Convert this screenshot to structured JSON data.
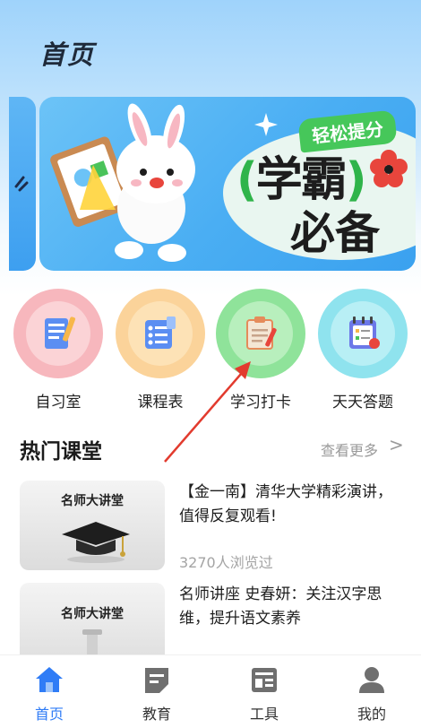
{
  "header": {
    "title": "首页"
  },
  "banner": {
    "tag": "轻松提分",
    "headline_bracket_left": "(",
    "headline_line1": "学霸",
    "headline_bracket_right": ")",
    "headline_line2": "必备",
    "accent_color": "#46c75a"
  },
  "shortcuts": [
    {
      "label": "自习室",
      "icon": "study-room-icon",
      "ring": "#f7b7bd",
      "inner": "#fbd3d6"
    },
    {
      "label": "课程表",
      "icon": "schedule-icon",
      "ring": "#fbd39a",
      "inner": "#fde2b6"
    },
    {
      "label": "学习打卡",
      "icon": "check-in-icon",
      "ring": "#8fe39a",
      "inner": "#b8efbd"
    },
    {
      "label": "天天答题",
      "icon": "daily-quiz-icon",
      "ring": "#8fe3ee",
      "inner": "#b8eff5"
    }
  ],
  "hot_courses": {
    "title": "热门课堂",
    "more_label": "查看更多",
    "more_chevron": ">",
    "items": [
      {
        "thumb_title": "名师大讲堂",
        "title": "【金一南】清华大学精彩演讲，值得反复观看!",
        "views": "3270人浏览过"
      },
      {
        "thumb_title": "名师大讲堂",
        "title": "名师讲座 史春妍：关注汉字思维，提升语文素养",
        "views": ""
      }
    ]
  },
  "tabbar": {
    "active_color": "#2f7cf6",
    "tabs": [
      {
        "label": "首页",
        "icon": "home-icon",
        "active": true
      },
      {
        "label": "教育",
        "icon": "education-icon",
        "active": false
      },
      {
        "label": "工具",
        "icon": "tools-icon",
        "active": false
      },
      {
        "label": "我的",
        "icon": "profile-icon",
        "active": false
      }
    ]
  }
}
